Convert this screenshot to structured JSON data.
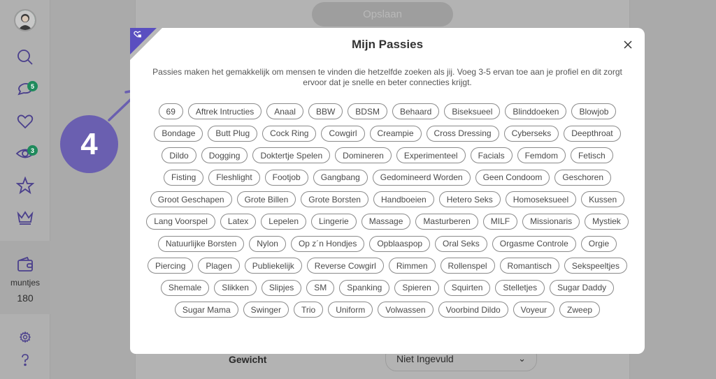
{
  "sidebar": {
    "items": [
      {
        "name": "profile",
        "icon": "avatar"
      },
      {
        "name": "search",
        "icon": "search-icon"
      },
      {
        "name": "messages",
        "icon": "chat-icon",
        "badge": "5"
      },
      {
        "name": "favorites",
        "icon": "heart-icon"
      },
      {
        "name": "visitors",
        "icon": "eye-icon",
        "badge": "3"
      },
      {
        "name": "starred",
        "icon": "star-icon"
      },
      {
        "name": "premium",
        "icon": "crown-icon"
      }
    ],
    "wallet": {
      "label": "muntjes",
      "value": "180",
      "icon": "wallet-icon"
    },
    "bottom": [
      {
        "name": "settings",
        "icon": "gear-icon"
      },
      {
        "name": "help",
        "icon": "question-icon"
      }
    ]
  },
  "background": {
    "save_label": "Opslaan",
    "weight_label": "Gewicht",
    "weight_value": "Niet Ingevuld"
  },
  "step": {
    "number": "4"
  },
  "modal": {
    "title": "Mijn Passies",
    "description": "Passies maken het gemakkelijk om mensen te vinden die hetzelfde zoeken als jij. Voeg 3-5 ervan toe aan je profiel en dit zorgt ervoor dat je snelle en beter connecties krijgt.",
    "ribbon_icon": "heart-lock-icon",
    "close_icon": "close-icon",
    "chips": [
      "69",
      "Aftrek Intructies",
      "Anaal",
      "BBW",
      "BDSM",
      "Behaard",
      "Biseksueel",
      "Blinddoeken",
      "Blowjob",
      "Bondage",
      "Butt Plug",
      "Cock Ring",
      "Cowgirl",
      "Creampie",
      "Cross Dressing",
      "Cyberseks",
      "Deepthroat",
      "Dildo",
      "Dogging",
      "Doktertje Spelen",
      "Domineren",
      "Experimenteel",
      "Facials",
      "Femdom",
      "Fetisch",
      "Fisting",
      "Fleshlight",
      "Footjob",
      "Gangbang",
      "Gedomineerd Worden",
      "Geen Condoom",
      "Geschoren",
      "Groot Geschapen",
      "Grote Billen",
      "Grote Borsten",
      "Handboeien",
      "Hetero Seks",
      "Homoseksueel",
      "Kussen",
      "Lang Voorspel",
      "Latex",
      "Lepelen",
      "Lingerie",
      "Massage",
      "Masturberen",
      "MILF",
      "Missionaris",
      "Mystiek",
      "Natuurlijke Borsten",
      "Nylon",
      "Op z´n Hondjes",
      "Opblaaspop",
      "Oral Seks",
      "Orgasme Controle",
      "Orgie",
      "Piercing",
      "Plagen",
      "Publiekelijk",
      "Reverse Cowgirl",
      "Rimmen",
      "Rollenspel",
      "Romantisch",
      "Sekspeeltjes",
      "Shemale",
      "Slikken",
      "Slipjes",
      "SM",
      "Spanking",
      "Spieren",
      "Squirten",
      "Stelletjes",
      "Sugar Daddy",
      "Sugar Mama",
      "Swinger",
      "Trio",
      "Uniform",
      "Volwassen",
      "Voorbind Dildo",
      "Voyeur",
      "Zweep"
    ]
  },
  "colors": {
    "accent": "#5a4fc0",
    "badge": "#1f8a5c",
    "step": "#6a5fb0"
  }
}
